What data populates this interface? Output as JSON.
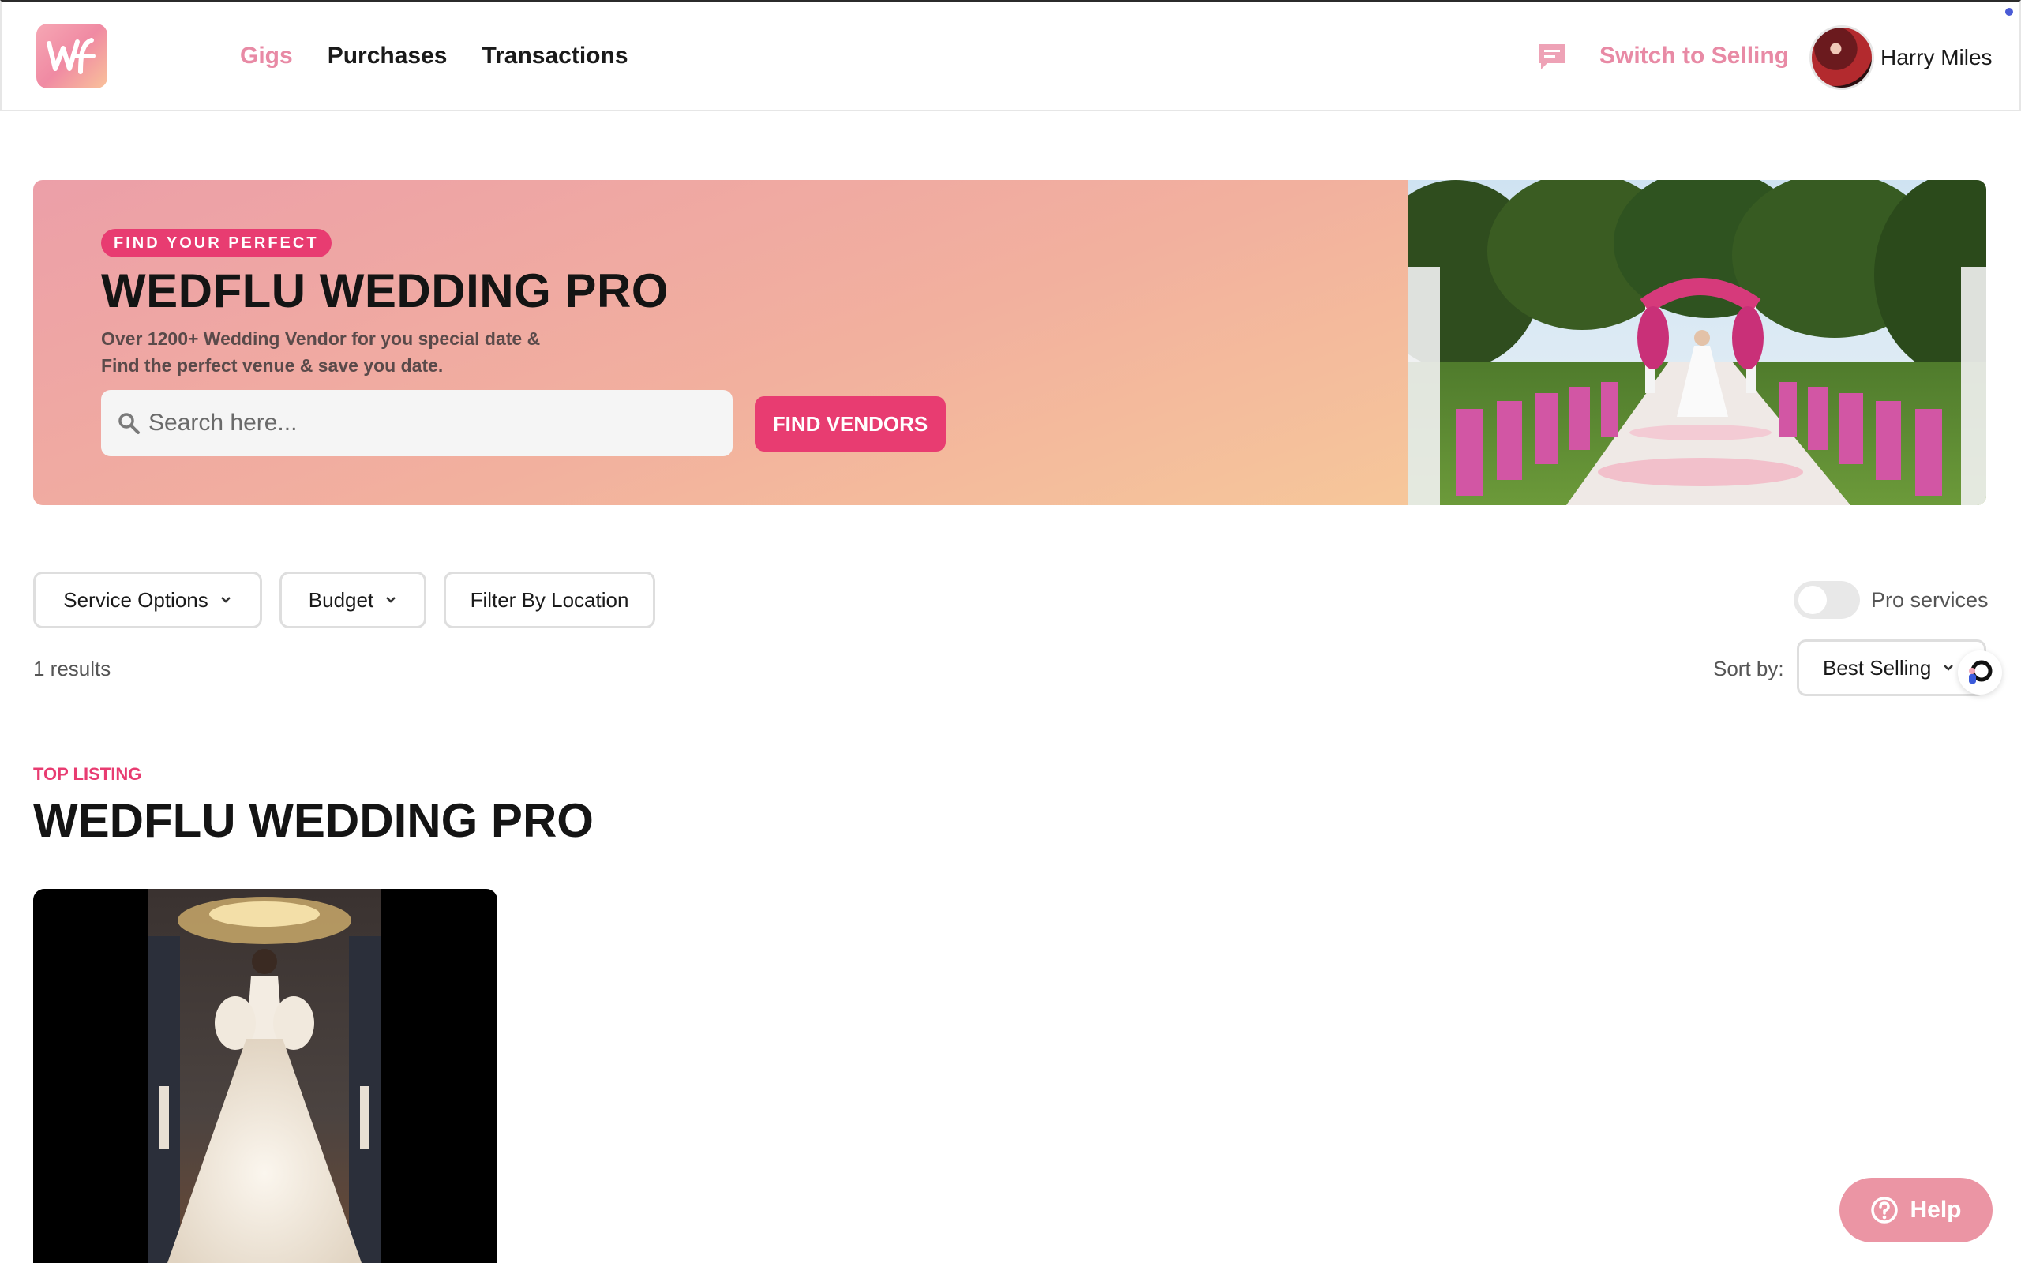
{
  "header": {
    "logo_text": "wf",
    "nav": [
      {
        "label": "Gigs",
        "active": true
      },
      {
        "label": "Purchases",
        "active": false
      },
      {
        "label": "Transactions",
        "active": false
      }
    ],
    "switch_label": "Switch to Selling",
    "user_name": "Harry Miles",
    "icons": {
      "messages": "chat-icon"
    }
  },
  "hero": {
    "badge": "FIND YOUR PERFECT",
    "title": "WEDFLU WEDDING PRO",
    "subtitle_line1": "Over 1200+ Wedding Vendor for you special date &",
    "subtitle_line2": "Find the perfect venue & save you date.",
    "search_placeholder": "Search here...",
    "button_label": "FIND VENDORS"
  },
  "filters": {
    "service_options": "Service Options",
    "budget": "Budget",
    "location": "Filter By Location",
    "pro_toggle_label": "Pro services",
    "pro_enabled": false
  },
  "results": {
    "count_text": "1 results",
    "sort_label": "Sort by:",
    "sort_value": "Best Selling"
  },
  "listing": {
    "eyebrow": "TOP LISTING",
    "title": "WEDFLU WEDDING PRO"
  },
  "help": {
    "label": "Help"
  },
  "colors": {
    "accent": "#e83c71",
    "accent_soft": "#e88aa5",
    "help_bg": "#eb95a4"
  }
}
